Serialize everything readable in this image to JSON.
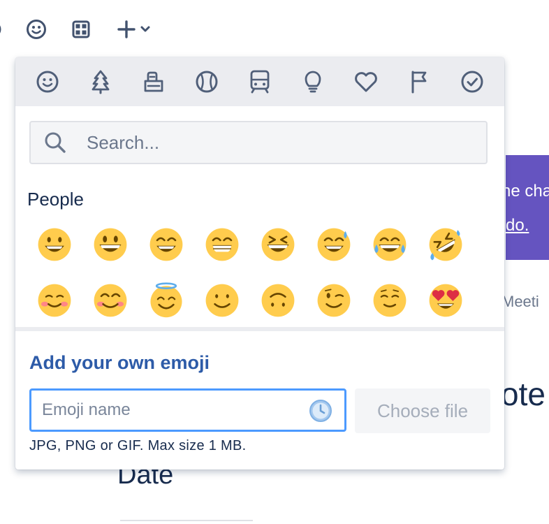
{
  "toolbar": {
    "icons": [
      "partial-icon",
      "emoji-icon",
      "table-icon",
      "plus-icon",
      "chevron-down-icon"
    ]
  },
  "background": {
    "purple_line1": "ne cha",
    "purple_line2": "do.",
    "meeting_text": "Meeti",
    "notes_text": "ote",
    "date_text": "Date"
  },
  "picker": {
    "categories": [
      "people",
      "nature",
      "foods",
      "activity",
      "travel",
      "objects",
      "symbols",
      "flags",
      "productivity"
    ],
    "search": {
      "placeholder": "Search...",
      "value": ""
    },
    "section_title": "People",
    "emojis": [
      "😀",
      "😃",
      "😄",
      "😁",
      "😆",
      "😅",
      "😂",
      "🤣",
      "☺️",
      "😊",
      "😇",
      "🙂",
      "🙃",
      "😉",
      "😌",
      "😍"
    ],
    "add": {
      "title": "Add your own emoji",
      "name_placeholder": "Emoji name",
      "name_value": "",
      "choose_file_label": "Choose file",
      "hint": "JPG, PNG or GIF. Max size 1 MB."
    }
  },
  "colors": {
    "accent": "#4c9aff",
    "link": "#2d5ba8",
    "category_bar": "#ebecf0",
    "icon": "#505f79",
    "purple_panel": "#6554c0"
  }
}
